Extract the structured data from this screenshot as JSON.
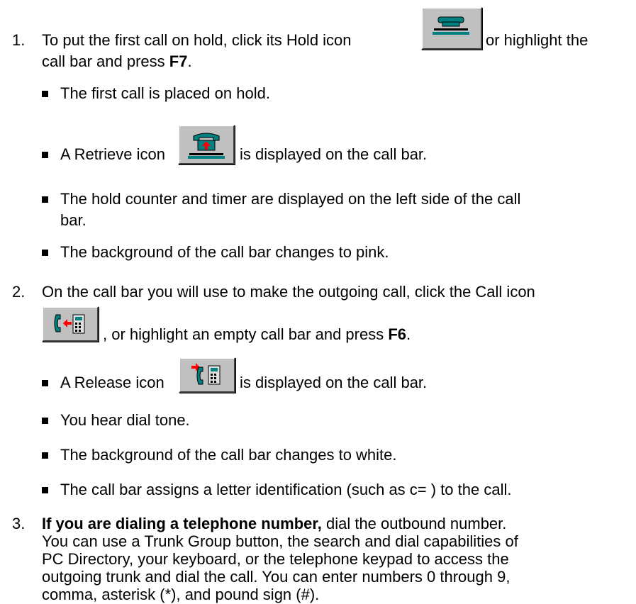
{
  "steps": [
    {
      "number": "1.",
      "line1_a": "To put the first call on hold, click its Hold icon",
      "line1_b": "or highlight the",
      "line2_a": "call bar and press ",
      "line2_key": "F7",
      "line2_b": ".",
      "hold_icon": "hold-phone-icon",
      "bullets": {
        "b1": "The first call is placed on hold.",
        "b2_a": "A Retrieve icon",
        "b2_b": "is displayed on the call bar.",
        "b3_l1": "The hold counter and timer are displayed on the left side of the call",
        "b3_l2": "bar.",
        "b4": "The background of the call bar changes to pink."
      }
    },
    {
      "number": "2.",
      "line1": "On the call bar you will use to make the outgoing call, click the Call icon",
      "line2_a": ", or highlight an empty call bar and press ",
      "line2_key": "F6",
      "line2_b": ".",
      "bullets": {
        "b1_a": "A Release icon",
        "b1_b": "is displayed on the call bar.",
        "b2": "You hear dial tone.",
        "b3": "The background of the call bar changes to white.",
        "b4": "The call bar assigns a letter identification (such as c= ) to the call."
      }
    },
    {
      "number": "3.",
      "line1_bold": "If you are dialing a telephone number,",
      "line1_rest": " dial the outbound number.",
      "line2": "You can use a Trunk Group button, the search and dial capabilities of",
      "line3": "PC Directory, your keyboard, or the telephone keypad to access the",
      "line4": "outgoing trunk and dial the call.  You can enter numbers 0 through 9,",
      "line5": "comma, asterisk (*), and pound sign (#)."
    }
  ],
  "icons": {
    "hold": "hold-phone-icon",
    "retrieve": "retrieve-phone-icon",
    "call": "call-phone-icon",
    "release": "release-phone-icon"
  },
  "colors": {
    "icon_teal": "#008080",
    "icon_red": "#ff0000",
    "button_face": "#c0c0c0"
  }
}
